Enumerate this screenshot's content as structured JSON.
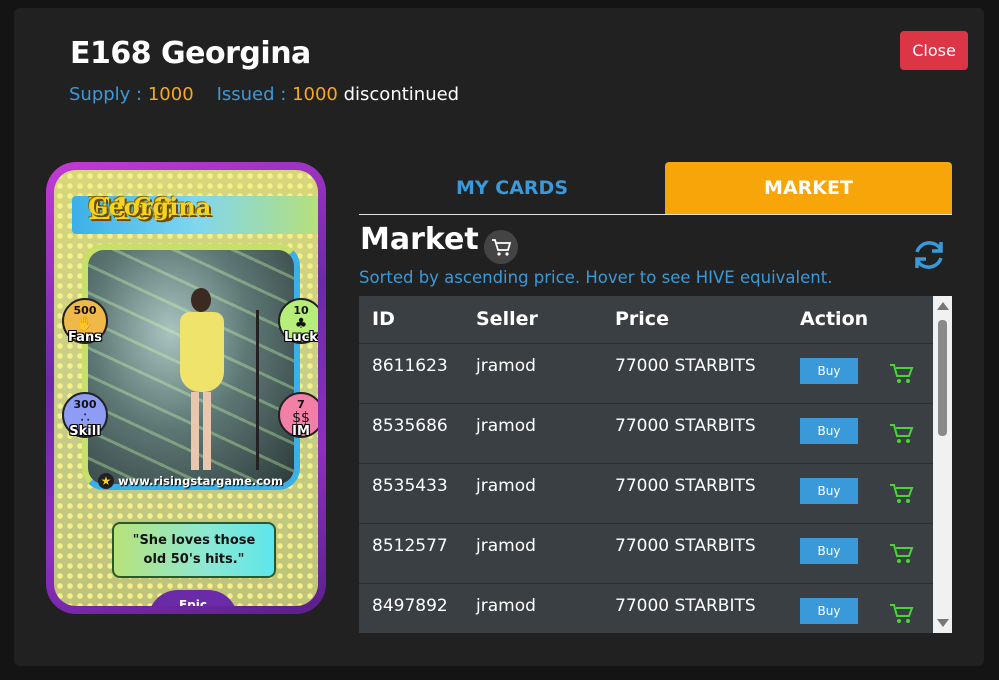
{
  "header": {
    "title": "E168 Georgina",
    "supply_label": "Supply :",
    "supply_value": "1000",
    "issued_label": "Issued :",
    "issued_value": "1000",
    "status": "discontinued",
    "close_label": "Close"
  },
  "card": {
    "code": "E168",
    "name": "Georgina",
    "stats": {
      "fans": {
        "value": "500",
        "label": "Fans"
      },
      "luck": {
        "value": "10",
        "label": "Luck"
      },
      "skill": {
        "value": "300",
        "label": "Skill"
      },
      "im": {
        "value": "7",
        "label": "IM"
      }
    },
    "website": "www.risingstargame.com",
    "quote_line1": "\"She loves those",
    "quote_line2": "old 50's hits.\"",
    "rarity": "Epic"
  },
  "tabs": [
    {
      "label": "MY CARDS",
      "active": false
    },
    {
      "label": "MARKET",
      "active": true
    }
  ],
  "market": {
    "heading": "Market",
    "sorted_text": "Sorted by ascending price. Hover to see HIVE equivalent.",
    "columns": [
      "ID",
      "Seller",
      "Price",
      "Action"
    ],
    "buy_label": "Buy",
    "rows": [
      {
        "id": "8611623",
        "seller": "jramod",
        "price": "77000 STARBITS"
      },
      {
        "id": "8535686",
        "seller": "jramod",
        "price": "77000 STARBITS"
      },
      {
        "id": "8535433",
        "seller": "jramod",
        "price": "77000 STARBITS"
      },
      {
        "id": "8512577",
        "seller": "jramod",
        "price": "77000 STARBITS"
      },
      {
        "id": "8497892",
        "seller": "jramod",
        "price": "77000 STARBITS"
      }
    ]
  },
  "icons": {
    "refresh": "refresh-icon",
    "cart": "cart-icon"
  },
  "colors": {
    "accent_blue": "#3a9ad9",
    "accent_orange": "#f8a50a",
    "close_red": "#dc3545",
    "cart_green": "#4cd137"
  }
}
